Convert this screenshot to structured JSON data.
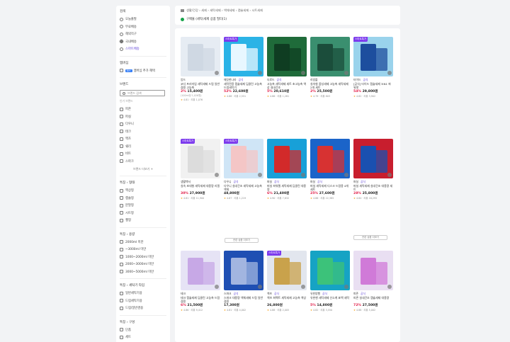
{
  "sidebar": {
    "delivery": {
      "title": "검색",
      "options": [
        "오늘출발",
        "무료배송",
        "해외직구",
        "국내배송",
        "스마트배송"
      ],
      "selected": 4
    },
    "benefit": {
      "title": "멤버십",
      "badge": "N+",
      "label": "멤버십 추가 혜택"
    },
    "brand": {
      "title": "브랜드",
      "placeholder": "브랜드 검색",
      "sub": "인기 브랜드",
      "options": [
        "피죤",
        "퍼실",
        "다우니",
        "테크",
        "액츠",
        "쉐리",
        "비트",
        "스파크"
      ],
      "more": "브랜드 더보기 +"
    },
    "type": {
      "title": "특징 › 형태",
      "options": [
        "액상형",
        "캡슐형",
        "분말형",
        "시트형",
        "젤형"
      ]
    },
    "capacity": {
      "title": "특징 › 용량",
      "options": [
        "2000ml 미만",
        "~3000ml 미만",
        "1000~2000ml 미만",
        "2000~3000ml 미만",
        "3000~5000ml 미만"
      ]
    },
    "target": {
      "title": "특징 › 세탁기 타입",
      "options": [
        "일반세탁기용",
        "드럼세탁기용",
        "드럼/일반겸용"
      ]
    },
    "scent": {
      "title": "특징 › 구성",
      "options": [
        "단품",
        "세트"
      ]
    }
  },
  "breadcrumb": {
    "path": "생활/건강 › 세제 › 세탁세제 › 액체세제 › 캡슐세제 › 시트세제",
    "filter": "구매율 (세탁)세제 상품 필터(1)"
  },
  "products": [
    {
      "brand": "앙드",
      "brand2": "",
      "title": "코디 프리미엄 세탁세제 드럼 일반 겸용 고농축",
      "orig": "",
      "pct": "2%",
      "price": "15,400원",
      "unit": "(100ml당 1,026원)",
      "tag": "",
      "tag2": "",
      "rating": "4.81 · 리뷰 1,076",
      "stag": ""
    },
    {
      "brand": "깨끗한나라",
      "brand2": "공식",
      "title": "세탁전용 캡슐세제 딥클린 고농축 드럼세탁기",
      "orig": "",
      "pct": "52%",
      "price": "22,600원",
      "unit": "",
      "tag": "",
      "tag2": "",
      "rating": "4.88 · 리뷰 2,551",
      "stag": "스마트특가"
    },
    {
      "brand": "더로드",
      "brand2": "공식",
      "title": "고농축 세탁세제 세트 초고농축 액상 실내건조",
      "orig": "",
      "pct": "5%",
      "price": "20,610원",
      "unit": "",
      "tag": "",
      "tag2": "",
      "rating": "4.86 · 리뷰 1,281",
      "stag": ""
    },
    {
      "brand": "리빙몰",
      "brand2": "",
      "title": "실속형 중성세제 고농축 세탁세제 2개 세트",
      "orig": "",
      "pct": "2%",
      "price": "25,500원",
      "unit": "",
      "tag": "",
      "tag2": "",
      "rating": "4.79 · 리뷰 803",
      "stag": ""
    },
    {
      "brand": "타이드",
      "brand2": "공식",
      "title": "[공식] 타이드 캡슐세제 3IN1 파워팟",
      "orig": "",
      "pct": "54%",
      "price": "29,800원",
      "unit": "",
      "tag": "",
      "tag2": "",
      "rating": "4.82 · 리뷰 3,902",
      "stag": "스마트특가"
    },
    {
      "brand": "생활백서",
      "brand2": "",
      "title": "실속 초대형 세탁세제 대용량 리필",
      "orig": "",
      "pct": "30%",
      "price": "27,900원",
      "unit": "",
      "tag": "",
      "tag2": "",
      "rating": "4.81 · 리뷰 11,900",
      "stag": "스마트특가"
    },
    {
      "brand": "다우니",
      "brand2": "공식",
      "title": "다우니 실내건조 세탁세제 고농축 액체",
      "orig": "",
      "pct": "",
      "price": "48,800원",
      "unit": "",
      "tag": "",
      "tag2": "",
      "rating": "4.87 · 리뷰 1,219",
      "stag": "스마트특가"
    },
    {
      "brand": "퍼실",
      "brand2": "공식",
      "title": "퍼실 파워젤 세탁세제 딥클린 대용량",
      "orig": "",
      "pct": "6%",
      "price": "21,400원",
      "unit": "",
      "tag": "",
      "tag2": "",
      "rating": "4.90 · 리뷰 7,832",
      "stag": ""
    },
    {
      "brand": "퍼실",
      "brand2": "공식",
      "title": "퍼실 세탁세제 디스크 드럼용 4개 세트",
      "orig": "",
      "pct": "25%",
      "price": "27,600원",
      "unit": "",
      "tag": "",
      "tag2": "",
      "rating": "4.86 · 리뷰 22,385",
      "stag": ""
    },
    {
      "brand": "퍼실",
      "brand2": "공식",
      "title": "퍼실 세탁세제 실내건조 대용량 세트",
      "orig": "",
      "pct": "28%",
      "price": "25,800원",
      "unit": "",
      "tag": "",
      "tag2": "",
      "rating": "4.84 · 리뷰 16,295",
      "stag": ""
    },
    {
      "brand": "테크",
      "brand2": "",
      "title": "테크 캡슐세제 딥클린 고농축 드럼겸용",
      "orig": "",
      "pct": "6%",
      "price": "21,500원",
      "unit": "",
      "tag": "",
      "tag2": "",
      "rating": "4.86 · 리뷰 9,412",
      "stag": ""
    },
    {
      "brand": "스파크",
      "brand2": "공식",
      "title": "스파크 대용량 액체세제 드럼 일반 겸용",
      "orig": "",
      "pct": "",
      "price": "17,300원",
      "unit": "",
      "tag": "",
      "tag2": "",
      "rating": "4.81 · 리뷰 4,002",
      "stag": ""
    },
    {
      "brand": "액츠",
      "brand2": "공식",
      "title": "액츠 퍼펙트 세탁세제 고농축 액상",
      "orig": "",
      "pct": "",
      "price": "26,800원",
      "unit": "",
      "tag": "",
      "tag2": "",
      "rating": "4.88 · 리뷰 2,005",
      "stag": "스마트특가"
    },
    {
      "brand": "유한양행",
      "brand2": "공식",
      "title": "유한젠 세탁세제 산소계 표백 세탁",
      "orig": "",
      "pct": "5%",
      "price": "14,800원",
      "unit": "",
      "tag": "",
      "tag2": "",
      "rating": "4.82 · 리뷰 3,550",
      "stag": ""
    },
    {
      "brand": "피죤",
      "brand2": "공식",
      "title": "피죤 실내건조 캡슐세제 대용량",
      "orig": "",
      "pct": "72%",
      "price": "27,500원",
      "unit": "",
      "tag": "",
      "tag2": "",
      "rating": "4.88 · 리뷰 5,002",
      "stag": ""
    }
  ],
  "more_buttons": [
    "관련 상품 더보기",
    "관련 상품 더보기"
  ],
  "colors": {
    "accent": "#5b3fd6",
    "sale": "#e11d48",
    "tag_purple": "#7c3aed"
  }
}
